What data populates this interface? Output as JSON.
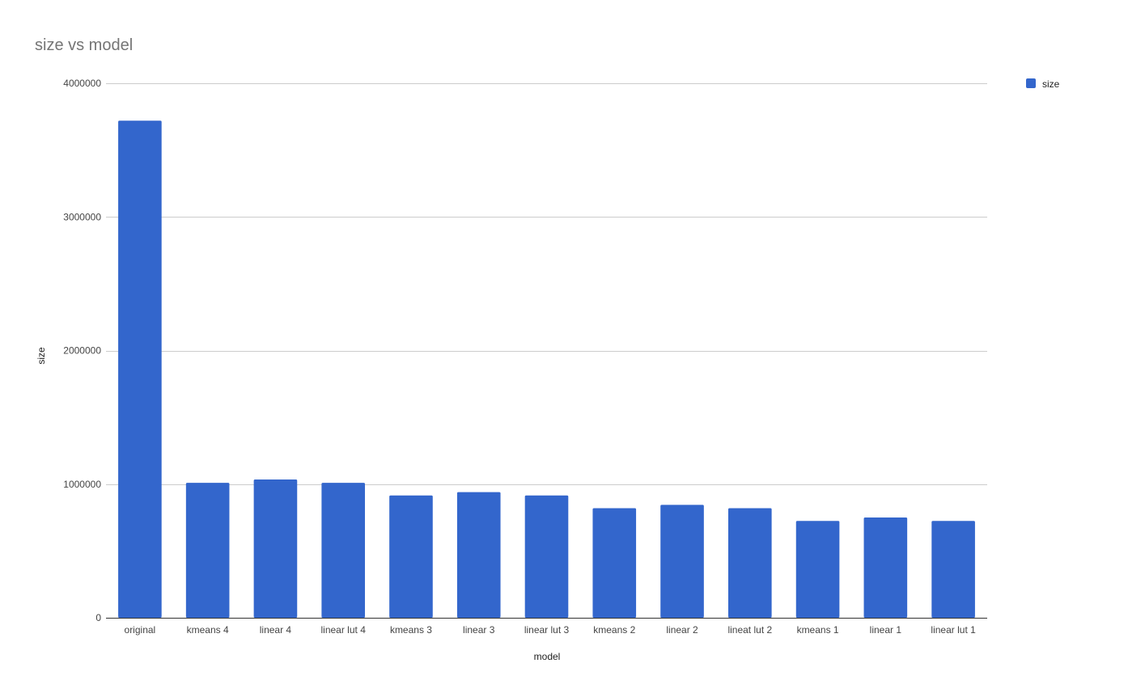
{
  "chart_data": {
    "type": "bar",
    "title": "size vs model",
    "xlabel": "model",
    "ylabel": "size",
    "categories": [
      "original",
      "kmeans 4",
      "linear 4",
      "linear lut 4",
      "kmeans 3",
      "linear 3",
      "linear lut 3",
      "kmeans 2",
      "linear 2",
      "lineat lut 2",
      "kmeans 1",
      "linear 1",
      "linear lut 1"
    ],
    "series": [
      {
        "name": "size",
        "color": "#3366cc",
        "values": [
          3720000,
          1010000,
          1035000,
          1010000,
          915000,
          940000,
          915000,
          820000,
          845000,
          820000,
          725000,
          750000,
          725000
        ]
      }
    ],
    "ylim": [
      0,
      4000000
    ],
    "yticks": [
      "0",
      "1000000",
      "2000000",
      "3000000",
      "4000000"
    ],
    "grid": true,
    "legend": {
      "position": "right",
      "labels": [
        "size"
      ]
    }
  }
}
